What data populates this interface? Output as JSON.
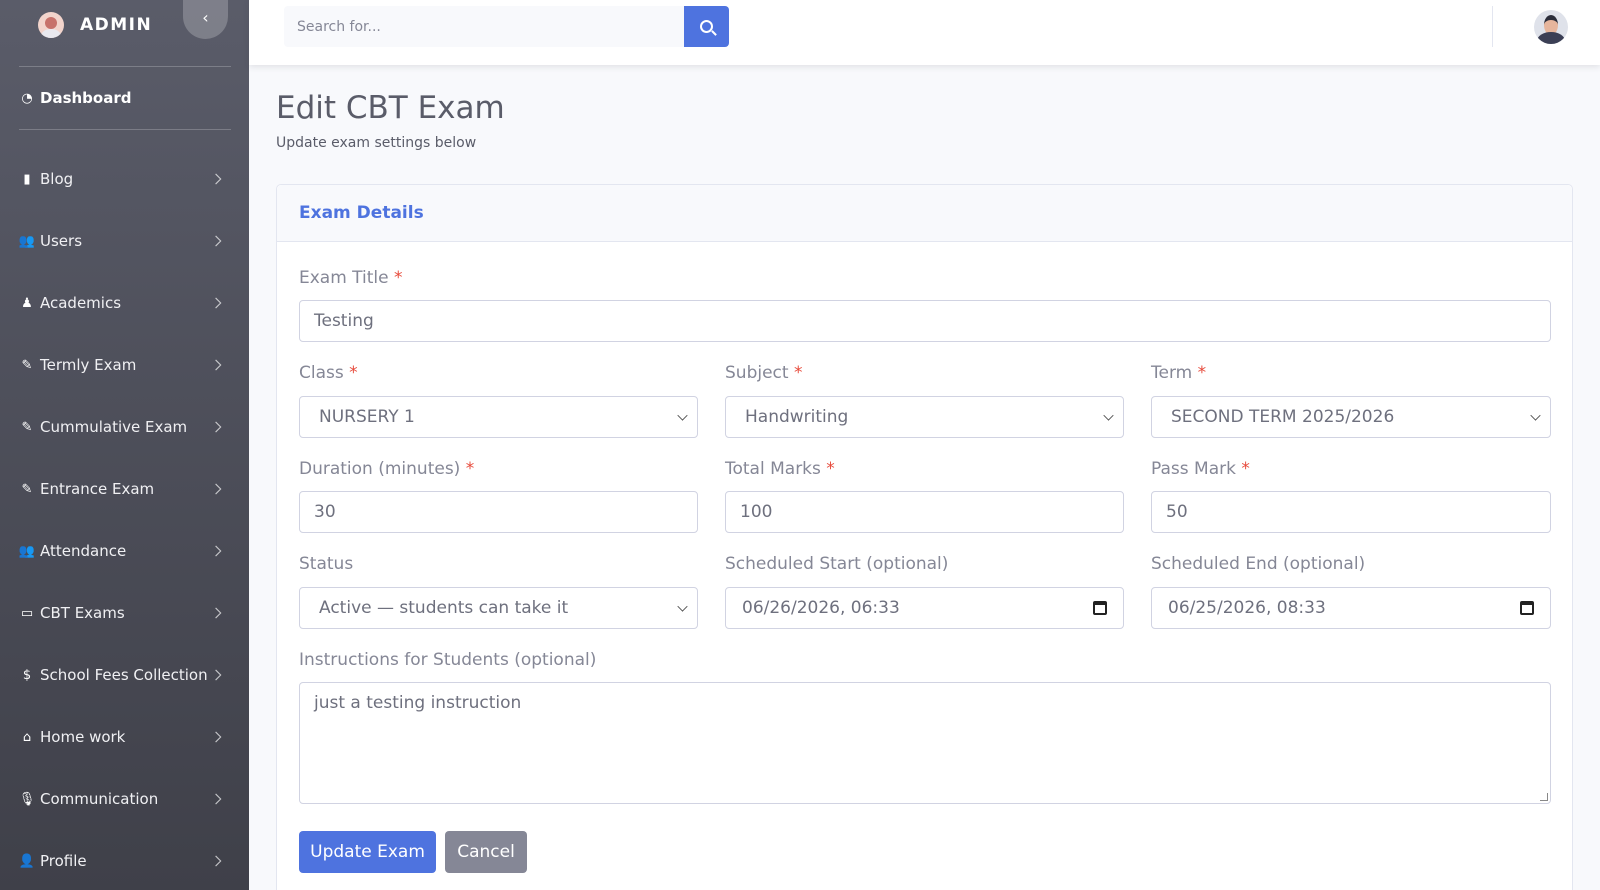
{
  "sidebar": {
    "brand": "ADMIN",
    "toggle_icon": "‹",
    "dashboard": {
      "icon": "◔",
      "label": "Dashboard"
    },
    "items": [
      {
        "icon": "▮",
        "label": "Blog"
      },
      {
        "icon": "👥",
        "label": "Users"
      },
      {
        "icon": "♟",
        "label": "Academics"
      },
      {
        "icon": "✎",
        "label": "Termly Exam"
      },
      {
        "icon": "✎",
        "label": "Cummulative Exam"
      },
      {
        "icon": "✎",
        "label": "Entrance Exam"
      },
      {
        "icon": "👥",
        "label": "Attendance"
      },
      {
        "icon": "▭",
        "label": "CBT Exams"
      },
      {
        "icon": "$",
        "label": "School Fees Collection"
      },
      {
        "icon": "⌂",
        "label": "Home work"
      },
      {
        "icon": "🎙",
        "label": "Communication"
      },
      {
        "icon": "👤",
        "label": "Profile"
      }
    ]
  },
  "topbar": {
    "search_placeholder": "Search for..."
  },
  "page": {
    "title": "Edit CBT Exam",
    "subtitle": "Update exam settings below"
  },
  "card": {
    "title": "Exam Details"
  },
  "form": {
    "exam_title": {
      "label": "Exam Title",
      "required": "*",
      "value": "Testing"
    },
    "class": {
      "label": "Class",
      "required": "*",
      "value": "NURSERY 1"
    },
    "subject": {
      "label": "Subject",
      "required": "*",
      "value": "Handwriting"
    },
    "term": {
      "label": "Term",
      "required": "*",
      "value": "SECOND TERM 2025/2026"
    },
    "duration": {
      "label": "Duration (minutes)",
      "required": "*",
      "value": "30"
    },
    "total_marks": {
      "label": "Total Marks",
      "required": "*",
      "value": "100"
    },
    "pass_mark": {
      "label": "Pass Mark",
      "required": "*",
      "value": "50"
    },
    "status": {
      "label": "Status",
      "value": "Active — students can take it"
    },
    "scheduled_start": {
      "label": "Scheduled Start (optional)",
      "value": "06/26/2026, 06:33"
    },
    "scheduled_end": {
      "label": "Scheduled End (optional)",
      "value": "06/25/2026, 08:33"
    },
    "instructions": {
      "label": "Instructions for Students (optional)",
      "value": "just a testing instruction"
    },
    "update_button": "Update Exam",
    "cancel_button": "Cancel"
  },
  "colors": {
    "primary": "#4e73df",
    "secondary": "#858796",
    "danger": "#e74a3b",
    "sidebar_top": "#5a5c69"
  }
}
